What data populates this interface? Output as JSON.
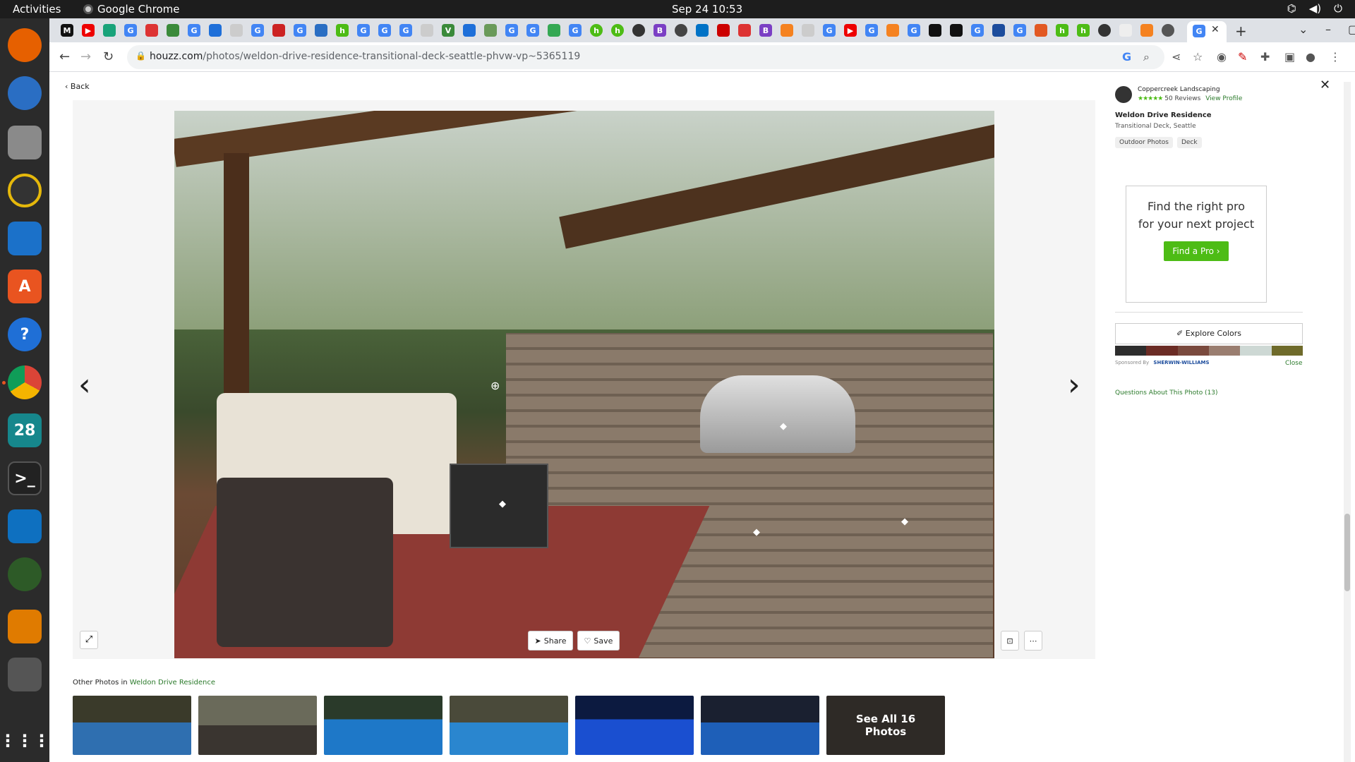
{
  "os": {
    "activities": "Activities",
    "app_name": "Google Chrome",
    "clock": "Sep 24  10:53",
    "dock_calendar": "28"
  },
  "browser": {
    "url_host": "houzz.com",
    "url_path": "/photos/weldon-drive-residence-transitional-deck-seattle-phvw-vp~5365119"
  },
  "page": {
    "back_label": "Back",
    "close_label": "✕",
    "share_label": "Share",
    "save_label": "Save",
    "pro": {
      "name": "Coppercreek Landscaping",
      "stars": "★★★★★",
      "reviews": "50 Reviews",
      "view_profile": "View Profile"
    },
    "photo_title": "Weldon Drive Residence",
    "photo_subtitle": "Transitional Deck, Seattle",
    "tags": [
      "Outdoor Photos",
      "Deck"
    ],
    "ad": {
      "heading_line1": "Find the right pro",
      "heading_line2": "for your next project",
      "button": "Find a Pro ›"
    },
    "explore_colors": "Explore Colors",
    "swatch_colors": [
      "#2d2d2d",
      "#6b2c25",
      "#7a4a3e",
      "#9a7e70",
      "#cdd8d4",
      "#6f6b2b"
    ],
    "sponsored_by": "Sponsored By",
    "sponsor_name": "SHERWIN-WILLIAMS",
    "close_ad": "Close",
    "questions": "Questions About This Photo (13)",
    "other_photos_prefix": "Other Photos in",
    "other_photos_link": "Weldon Drive Residence",
    "see_all_line1": "See All 16",
    "see_all_line2": "Photos"
  }
}
